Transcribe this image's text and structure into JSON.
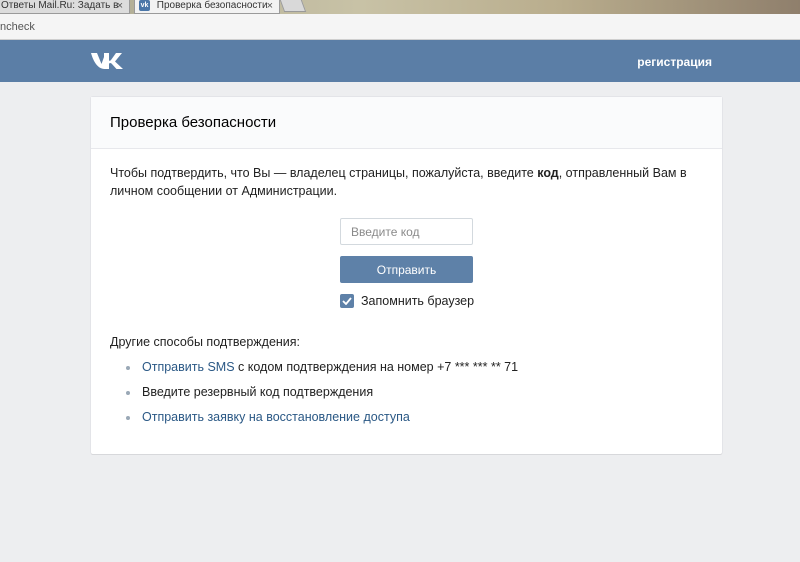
{
  "browser": {
    "tabs": [
      {
        "label": "Ответы Mail.Ru: Задать в",
        "active": false
      },
      {
        "label": "Проверка безопасности",
        "active": true
      }
    ],
    "url_fragment": "ncheck",
    "close_glyph": "×"
  },
  "header": {
    "logo": "vk-logo-icon",
    "register_link": "регистрация",
    "bg_color": "#5b7ea6"
  },
  "card": {
    "title": "Проверка безопасности",
    "description_before": "Чтобы подтвердить, что Вы — владелец страницы, пожалуйста, введите ",
    "description_bold": "код",
    "description_after": ", отправленный Вам в личном сообщении от Администрации.",
    "code_input": {
      "placeholder": "Введите код",
      "value": ""
    },
    "submit_label": "Отправить",
    "remember": {
      "label": "Запомнить браузер",
      "checked": true
    },
    "other_title": "Другие способы подтверждения:",
    "methods": {
      "sms_link": "Отправить SMS",
      "sms_rest": " с кодом подтверждения на номер +7 *** *** ** 71",
      "backup_code": "Введите резервный код подтверждения",
      "restore_link": "Отправить заявку на восстановление доступа"
    },
    "accent_color": "#5e81a8",
    "link_color": "#2a5885"
  }
}
